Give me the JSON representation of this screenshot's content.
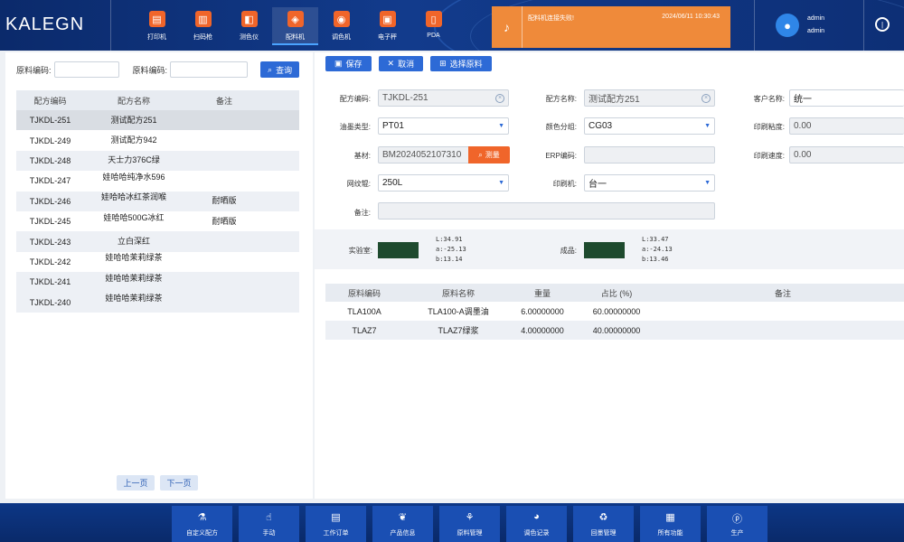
{
  "header": {
    "logo": "KALEGN",
    "devices": [
      {
        "label": "打印机",
        "icon": "printer-icon",
        "glyph": "▤"
      },
      {
        "label": "扫码枪",
        "icon": "barcode-scanner-icon",
        "glyph": "▥"
      },
      {
        "label": "测色仪",
        "icon": "colorimeter-icon",
        "glyph": "◧"
      },
      {
        "label": "配料机",
        "icon": "dispenser-icon",
        "glyph": "◈"
      },
      {
        "label": "调色机",
        "icon": "tinting-machine-icon",
        "glyph": "◉"
      },
      {
        "label": "电子秤",
        "icon": "scale-icon",
        "glyph": "▣"
      },
      {
        "label": "PDA",
        "icon": "pda-icon",
        "glyph": "▯"
      }
    ],
    "alert": {
      "message": "配料机连接失败!",
      "time": "2024/06/11 10:30:43"
    },
    "user": {
      "line1": "admin",
      "line2": "admin"
    }
  },
  "left": {
    "search": {
      "label1": "原料编码:",
      "label2": "原料编码:",
      "value1": "",
      "value2": "",
      "button": "查询"
    },
    "columns": [
      "配方编码",
      "配方名称",
      "备注"
    ],
    "rows": [
      {
        "code": "TJKDL-251",
        "name": "测试配方251",
        "note": ""
      },
      {
        "code": "TJKDL-249",
        "name": "测试配方942",
        "note": ""
      },
      {
        "code": "TJKDL-248",
        "name": "天士力376C绿",
        "note": ""
      },
      {
        "code": "TJKDL-247",
        "name": "娃哈哈纯净水596",
        "note": ""
      },
      {
        "code": "TJKDL-246",
        "name": "娃哈哈冰红茶润喉",
        "note": "耐晒版"
      },
      {
        "code": "TJKDL-245",
        "name": "娃哈哈500G冰红",
        "note": "耐晒版"
      },
      {
        "code": "TJKDL-243",
        "name": "立白深红",
        "note": ""
      },
      {
        "code": "TJKDL-242",
        "name": "娃哈哈茉莉绿茶",
        "note": ""
      },
      {
        "code": "TJKDL-241",
        "name": "娃哈哈茉莉绿茶",
        "note": ""
      },
      {
        "code": "TJKDL-240",
        "name": "娃哈哈茉莉绿茶",
        "note": ""
      }
    ],
    "pager": {
      "prev": "上一页",
      "next": "下一页"
    }
  },
  "toolbar": {
    "save": "保存",
    "cancel": "取消",
    "select": "选择原料"
  },
  "form": {
    "formula_code_label": "配方编码:",
    "formula_code": "TJKDL-251",
    "formula_name_label": "配方名称:",
    "formula_name": "测试配方251",
    "customer_label": "客户名称:",
    "customer": "统一",
    "ink_type_label": "油墨类型:",
    "ink_type": "PT01",
    "color_group_label": "颜色分组:",
    "color_group": "CG03",
    "viscosity_label": "印刷粘度:",
    "viscosity": "0.00",
    "substrate_label": "基材:",
    "substrate": "BM2024052107310",
    "measure": "测量",
    "erp_label": "ERP编码:",
    "erp": "",
    "speed_label": "印刷速度:",
    "speed": "0.00",
    "anilox_label": "网纹辊:",
    "anilox": "250L",
    "press_label": "印刷机:",
    "press": "台一",
    "remark_label": "备注:",
    "remark": ""
  },
  "colors": {
    "lab_label": "实验室:",
    "lab_L": "L:34.91",
    "lab_a": "a:-25.13",
    "lab_b": "b:13.14",
    "product_label": "成品:",
    "prod_L": "L:33.47",
    "prod_a": "a:-24.13",
    "prod_b": "b:13.46",
    "swatch_color": "#1e4a2e"
  },
  "materials": {
    "columns": [
      "原料编码",
      "原料名称",
      "重量",
      "占比 (%)",
      "备注"
    ],
    "rows": [
      {
        "code": "TLA100A",
        "name": "TLA100-A调墨油",
        "weight": "6.00000000",
        "ratio": "60.00000000",
        "note": ""
      },
      {
        "code": "TLAZ7",
        "name": "TLAZ7绿浆",
        "weight": "4.00000000",
        "ratio": "40.00000000",
        "note": ""
      }
    ]
  },
  "bottom_nav": [
    {
      "label": "自定义配方",
      "icon": "flask-icon",
      "glyph": "⚗"
    },
    {
      "label": "手动",
      "icon": "hand-icon",
      "glyph": "☝"
    },
    {
      "label": "工作订单",
      "icon": "order-icon",
      "glyph": "▤"
    },
    {
      "label": "产品信息",
      "icon": "leaf-icon",
      "glyph": "❦"
    },
    {
      "label": "原料管理",
      "icon": "sprout-icon",
      "glyph": "⚘"
    },
    {
      "label": "调色记录",
      "icon": "palette-icon",
      "glyph": "◕"
    },
    {
      "label": "回墨管理",
      "icon": "recycle-icon",
      "glyph": "♻"
    },
    {
      "label": "所有功能",
      "icon": "grid-icon",
      "glyph": "▦"
    },
    {
      "label": "生产",
      "icon": "production-icon",
      "glyph": "ⓟ"
    }
  ]
}
